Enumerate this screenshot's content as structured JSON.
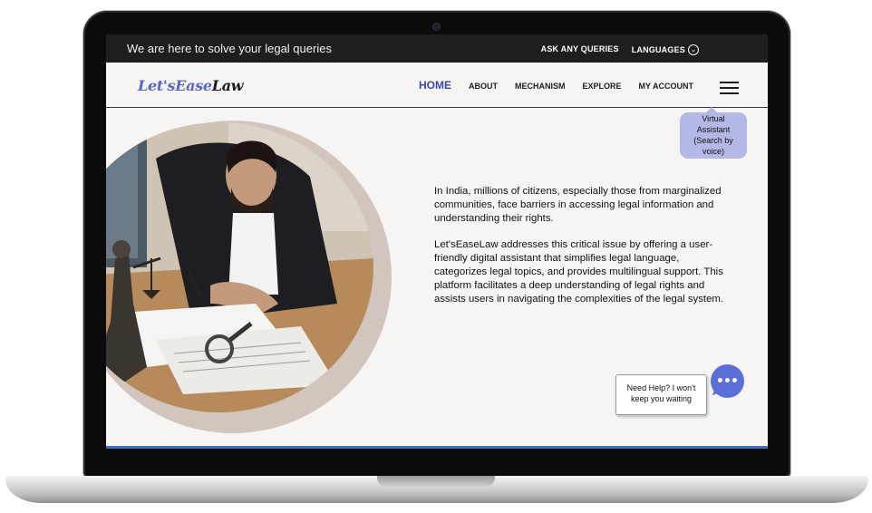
{
  "topbar": {
    "tagline": "We are here to solve your legal queries",
    "ask_queries": "ASK ANY QUERIES",
    "languages": "LANGUAGES"
  },
  "brand": {
    "part1": "Let'sEase",
    "part2": "Law"
  },
  "nav": {
    "items": [
      {
        "label": "HOME",
        "active": true
      },
      {
        "label": "ABOUT"
      },
      {
        "label": "MECHANISM"
      },
      {
        "label": "EXPLORE"
      },
      {
        "label": "MY ACCOUNT"
      }
    ],
    "menu_icon": "hamburger-icon"
  },
  "assistant": {
    "line1": "Virtual",
    "line2": "Assistant",
    "line3": "(Search by",
    "line4": "voice)"
  },
  "hero": {
    "paragraph1": "In India, millions of citizens, especially those from marginalized communities, face barriers in accessing legal information and understanding their rights.",
    "paragraph2": "Let'sEaseLaw addresses this critical issue by offering a user-friendly digital assistant that simplifies legal language, categorizes legal topics, and provides multilingual support. This platform facilitates a deep understanding of legal rights and assists users in navigating the complexities of the legal system."
  },
  "chat": {
    "help_line1": "Need Help? I won't",
    "help_line2": "keep you waiting",
    "icon": "chat-bubble-icon"
  },
  "colors": {
    "brand_blue": "#5b63c9",
    "topbar": "#1d1e20",
    "chat_button": "#5b6fd8",
    "assistant_bg": "#b4b8e6"
  }
}
